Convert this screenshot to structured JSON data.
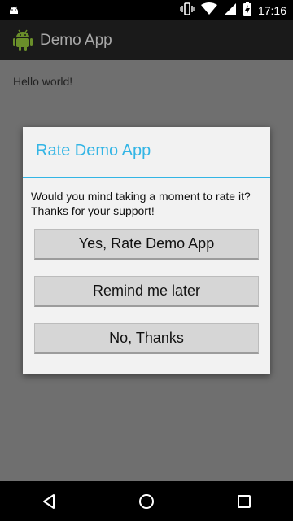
{
  "status_bar": {
    "time": "17:16",
    "icons": [
      "android-notification-icon",
      "vibrate-icon",
      "wifi-icon",
      "signal-icon",
      "battery-charging-icon"
    ]
  },
  "action_bar": {
    "title": "Demo App",
    "icon": "android-app-icon"
  },
  "content": {
    "text": "Hello world!"
  },
  "dialog": {
    "title": "Rate Demo App",
    "message": "Would you mind taking a moment to rate it? Thanks for your support!",
    "buttons": [
      {
        "label": "Yes, Rate Demo App"
      },
      {
        "label": "Remind me later"
      },
      {
        "label": "No, Thanks"
      }
    ],
    "accent_color": "#33b5e5"
  },
  "nav_bar": {
    "buttons": [
      "back-icon",
      "home-icon",
      "recents-icon"
    ]
  }
}
